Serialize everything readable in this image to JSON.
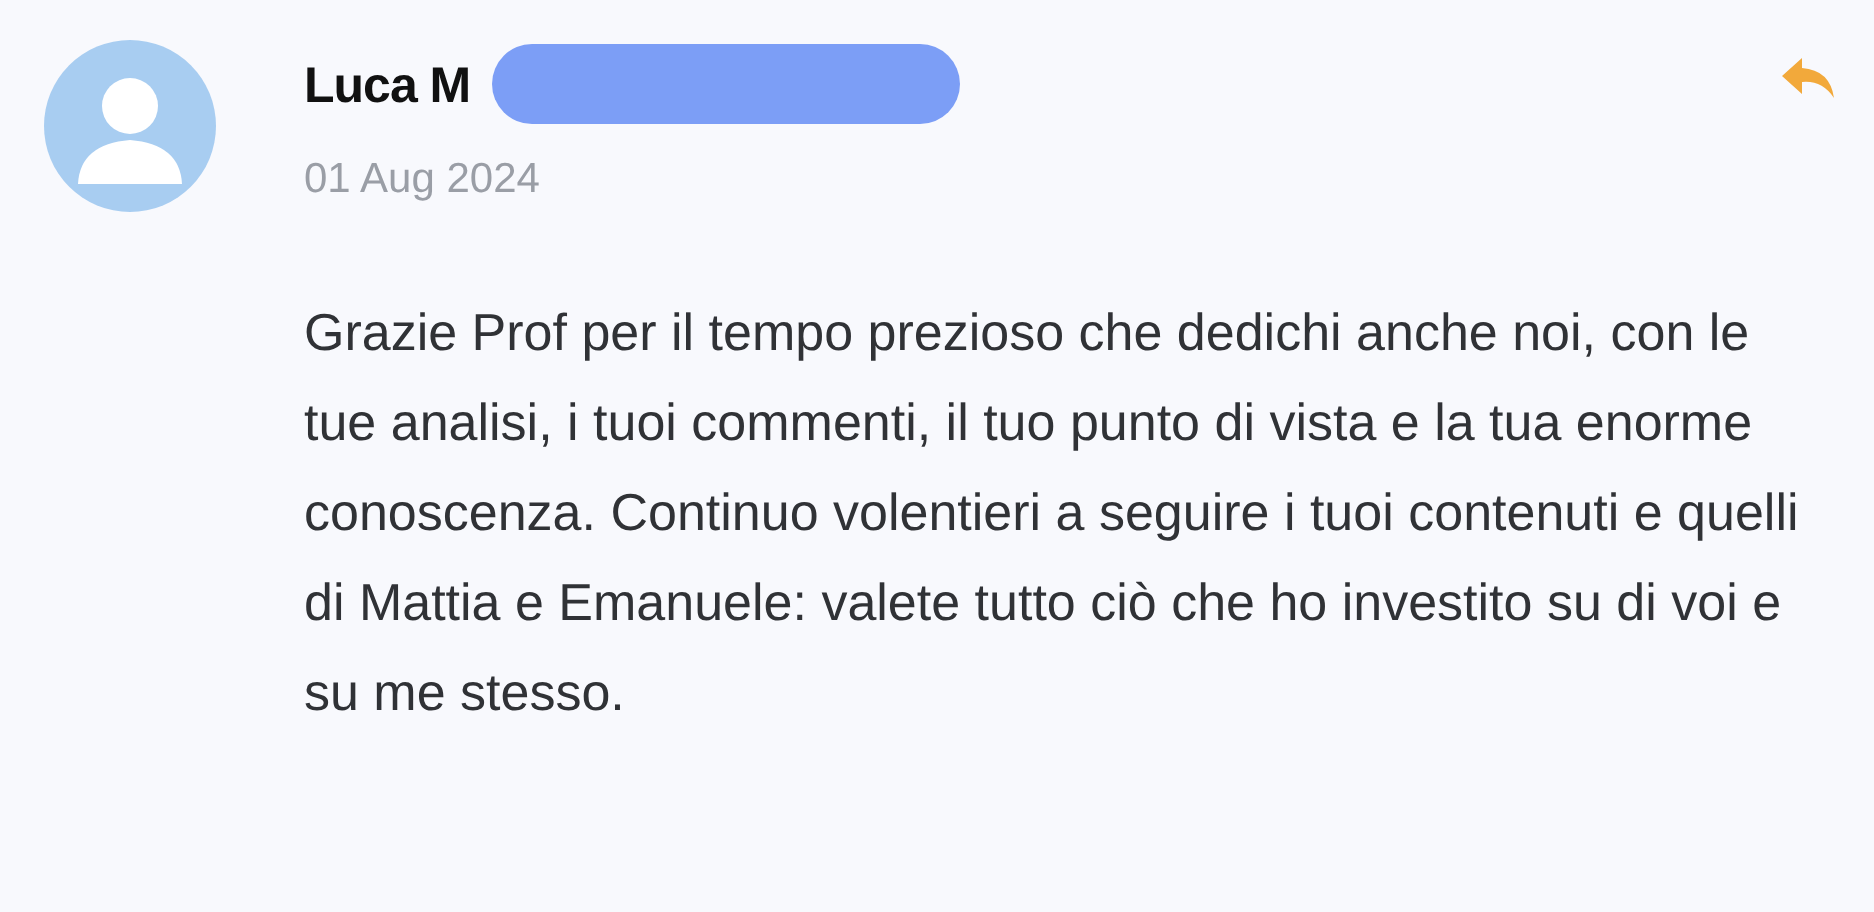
{
  "comment": {
    "author": "Luca M",
    "date": "01 Aug 2024",
    "text": "Grazie Prof per il tempo prezioso che dedichi anche noi, con le tue analisi, i tuoi commenti, il tuo punto di vista e la tua enorme conoscenza. Continuo volentieri a seguire i tuoi contenuti e quelli di Mattia e Emanuele: valete tutto ciò che ho investito su di voi e su me stesso."
  }
}
